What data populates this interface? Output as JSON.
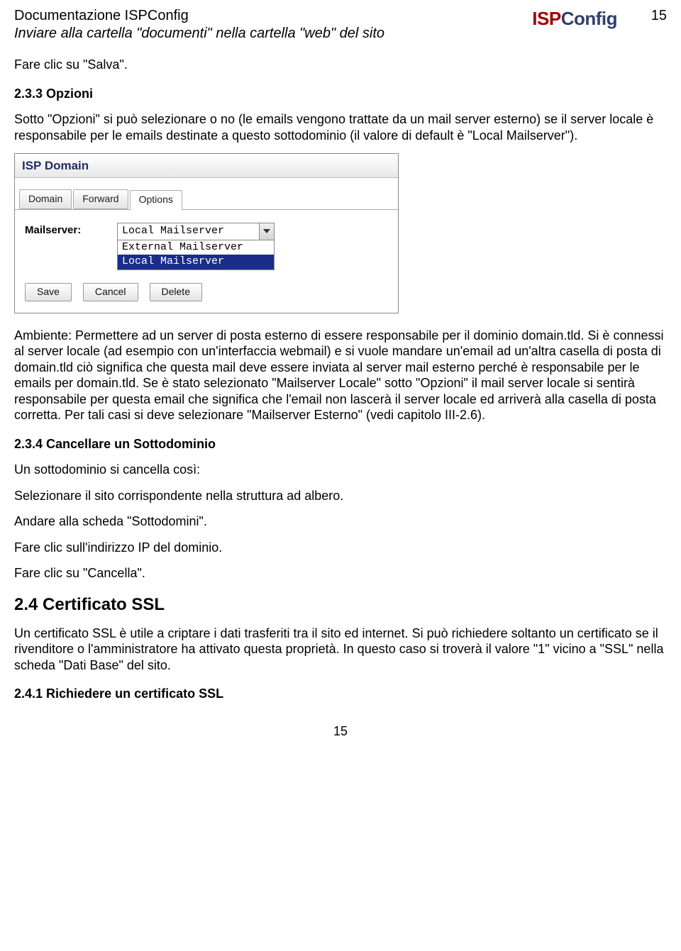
{
  "header": {
    "title": "Documentazione ISPConfig",
    "subtitle": "Inviare alla cartella \"documenti\" nella cartella \"web\" del sito",
    "logo_isp": "ISP",
    "logo_config": "Config",
    "page_no_top": "15"
  },
  "body": {
    "p1": "Fare clic su \"Salva\".",
    "h1": "2.3.3 Opzioni",
    "p2": "Sotto \"Opzioni\" si può selezionare o no (le emails vengono trattate da un mail server esterno) se il server locale è responsabile per le emails destinate a questo sottodominio (il valore di default è \"Local Mailserver\").",
    "p3": "Ambiente: Permettere ad un server di posta esterno di essere responsabile per il dominio domain.tld. Si è connessi al server locale (ad esempio con un'interfaccia webmail) e si vuole mandare un'email ad un'altra casella di posta di domain.tld ciò significa che questa mail deve essere inviata al server mail esterno perché è responsabile per le emails per domain.tld. Se è stato selezionato \"Mailserver Locale\" sotto \"Opzioni\" il mail server locale si sentirà responsabile per questa email che significa che l'email non lascerà il server locale ed arriverà alla casella di posta corretta. Per tali casi si deve selezionare \"Mailserver Esterno\" (vedi capitolo III-2.6).",
    "h2": "2.3.4 Cancellare un Sottodominio",
    "p4": "Un sottodominio si cancella così:",
    "p5": "Selezionare il sito corrispondente nella struttura ad albero.",
    "p6": "Andare alla scheda \"Sottodomini\".",
    "p7": "Fare clic sull'indirizzo IP del dominio.",
    "p8": "Fare clic su \"Cancella\".",
    "h3": "2.4 Certificato SSL",
    "p9": "Un certificato SSL è utile a criptare i dati trasferiti tra il sito ed internet. Si può richiedere soltanto un certificato se il rivenditore o l'amministratore ha attivato questa proprietà. In questo caso si troverà il valore \"1\" vicino a \"SSL\" nella scheda \"Dati Base\" del sito.",
    "h4": "2.4.1 Richiedere un certificato SSL"
  },
  "panel": {
    "title": "ISP Domain",
    "tabs": [
      "Domain",
      "Forward",
      "Options"
    ],
    "active_tab_index": 2,
    "field_label": "Mailserver:",
    "combo_value": "Local Mailserver",
    "combo_options": [
      "External Mailserver",
      "Local Mailserver"
    ],
    "selected_option_index": 1,
    "buttons": [
      "Save",
      "Cancel",
      "Delete"
    ]
  },
  "footer": {
    "page_no": "15"
  }
}
